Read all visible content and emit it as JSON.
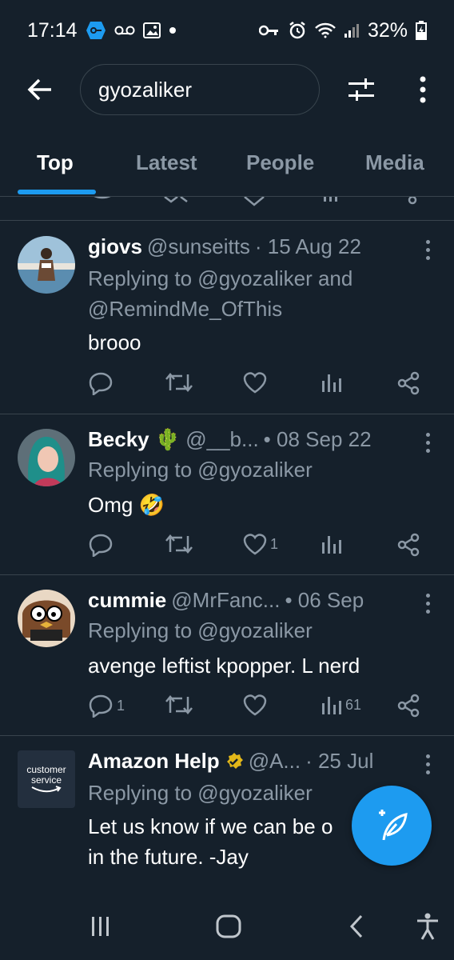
{
  "status_bar": {
    "time": "17:14",
    "battery": "32%",
    "icons_left": [
      "vpn-key-icon",
      "voicemail-icon",
      "gallery-icon",
      "notification-dot-icon"
    ],
    "icons_right": [
      "key-icon",
      "alarm-icon",
      "wifi-icon",
      "signal-icon",
      "battery-icon"
    ]
  },
  "search": {
    "query": "gyozaliker"
  },
  "tabs": [
    {
      "label": "Top",
      "active": true
    },
    {
      "label": "Latest",
      "active": false
    },
    {
      "label": "People",
      "active": false
    },
    {
      "label": "Media",
      "active": false
    }
  ],
  "tweets": [
    {
      "name": "giovs",
      "handle": "@sunseitts",
      "date": "· 15 Aug 22",
      "reply_line_1": "Replying to @gyozaliker and",
      "reply_line_2": "@RemindMe_OfThis",
      "text": "brooo",
      "counts": {
        "reply": "",
        "retweet": "",
        "like": "",
        "views": ""
      }
    },
    {
      "name": "Becky 🌵",
      "handle": "@__b...",
      "date": "• 08 Sep 22",
      "reply_line_1": "Replying to @gyozaliker",
      "text": "Omg 🤣",
      "counts": {
        "reply": "",
        "retweet": "",
        "like": "1",
        "views": ""
      }
    },
    {
      "name": "cummie",
      "handle": "@MrFanc...",
      "date": "• 06 Sep",
      "reply_line_1": "Replying to @gyozaliker",
      "text": "avenge leftist kpopper. L nerd",
      "counts": {
        "reply": "1",
        "retweet": "",
        "like": "",
        "views": "61"
      }
    },
    {
      "name": "Amazon Help",
      "handle": "@A...",
      "date": "· 25 Jul",
      "reply_line_1": "Replying to @gyozaliker",
      "text_line_1": "Let us know if we can be o",
      "text_line_2": "in the future. -Jay",
      "avatar_text_1": "customer",
      "avatar_text_2": "service"
    }
  ],
  "colors": {
    "background": "#15202b",
    "accent": "#1d9bf0",
    "muted": "#8b98a5",
    "divider": "#38444d"
  }
}
